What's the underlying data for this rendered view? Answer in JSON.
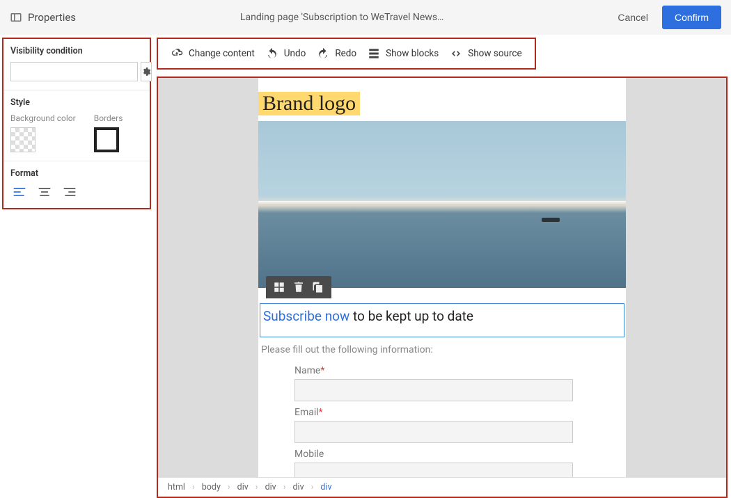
{
  "header": {
    "panel_label": "Properties",
    "title": "Landing page 'Subscription to WeTravel News…",
    "cancel": "Cancel",
    "confirm": "Confirm"
  },
  "properties": {
    "visibility_title": "Visibility condition",
    "style_title": "Style",
    "bg_label": "Background color",
    "borders_label": "Borders",
    "format_title": "Format"
  },
  "toolbar": {
    "change": "Change content",
    "undo": "Undo",
    "redo": "Redo",
    "show_blocks": "Show blocks",
    "show_source": "Show source"
  },
  "doc": {
    "brand_logo": "Brand logo",
    "headline_link": "Subscribe now",
    "headline_rest": " to be kept up to date",
    "form_intro": "Please fill out the following information:",
    "fields": {
      "name": "Name",
      "email": "Email",
      "mobile": "Mobile"
    }
  },
  "breadcrumb": [
    "html",
    "body",
    "div",
    "div",
    "div",
    "div"
  ]
}
